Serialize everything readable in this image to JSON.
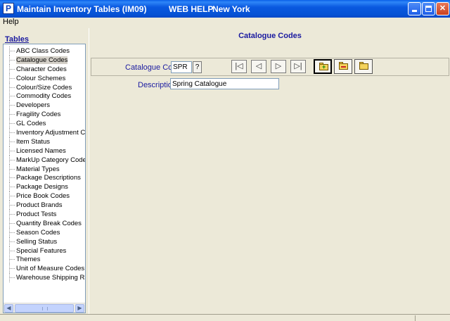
{
  "window": {
    "app_icon": "P",
    "title": "Maintain Inventory Tables (IM09)",
    "help_text": "WEB HELP",
    "city": "New York"
  },
  "menu": {
    "help_label": "Help"
  },
  "sidebar": {
    "heading": "Tables",
    "items": [
      "ABC Class Codes",
      "Catalogue Codes",
      "Character Codes",
      "Colour Schemes",
      "Colour/Size Codes",
      "Commodity Codes",
      "Developers",
      "Fragility Codes",
      "GL Codes",
      "Inventory Adjustment Codes",
      "Item Status",
      "Licensed Names",
      "MarkUp Category Codes",
      "Material Types",
      "Package Descriptions",
      "Package Designs",
      "Price Book Codes",
      "Product Brands",
      "Product Tests",
      "Quantity Break Codes",
      "Season Codes",
      "Selling Status",
      "Special Features",
      "Themes",
      "Unit of Measure Codes",
      "Warehouse Shipping Rates"
    ],
    "selected_index": 1
  },
  "main": {
    "title": "Catalogue Codes",
    "code_label": "Catalogue Code",
    "code_value": "SPR",
    "lookup_label": "?",
    "description_label": "Description",
    "description_value": "Spring Catalogue"
  },
  "colors": {
    "title_bar": "#0653D6",
    "label_blue": "#1a1aa0",
    "background": "#ECE9D8"
  }
}
